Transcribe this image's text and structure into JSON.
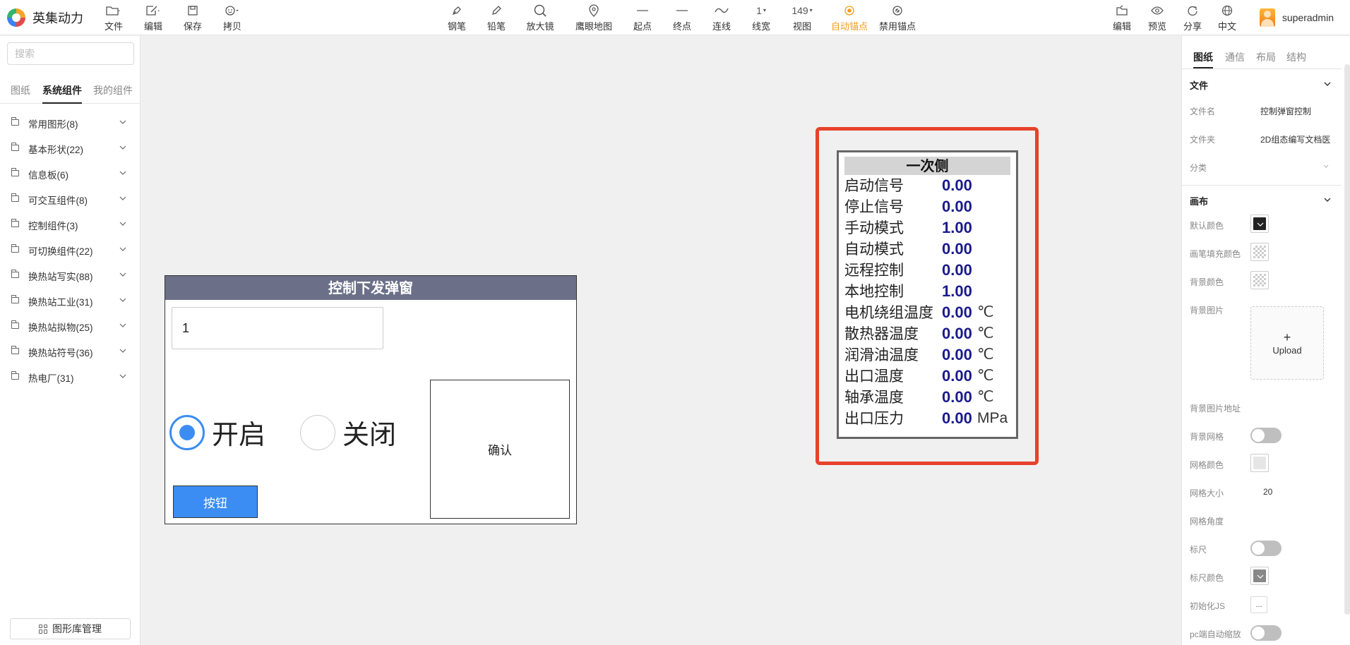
{
  "app": {
    "name": "英集动力",
    "user": "superadmin"
  },
  "toolbar": {
    "left": [
      {
        "label": "文件",
        "icon": "folder-icon"
      },
      {
        "label": "编辑",
        "icon": "edit-icon"
      },
      {
        "label": "保存",
        "icon": "save-icon"
      },
      {
        "label": "拷贝",
        "icon": "smile-icon"
      }
    ],
    "center": [
      {
        "label": "钢笔",
        "icon": "pen-icon"
      },
      {
        "label": "铅笔",
        "icon": "pencil-icon"
      },
      {
        "label": "放大镜",
        "icon": "magnifier-icon"
      },
      {
        "label": "鹰眼地图",
        "icon": "map-pin-icon"
      },
      {
        "label": "起点",
        "icon": "line-start-icon"
      },
      {
        "label": "终点",
        "icon": "line-end-icon"
      },
      {
        "label": "连线",
        "icon": "curve-icon"
      },
      {
        "label": "线宽",
        "value": "1"
      },
      {
        "label": "视图",
        "value": "149"
      },
      {
        "label": "自动锚点",
        "icon": "anchor-icon",
        "active": true
      },
      {
        "label": "禁用锚点",
        "icon": "anchor-disabled-icon"
      }
    ],
    "right": [
      {
        "label": "编辑",
        "icon": "edit-folder-icon"
      },
      {
        "label": "预览",
        "icon": "eye-icon"
      },
      {
        "label": "分享",
        "icon": "share-icon"
      },
      {
        "label": "中文",
        "icon": "globe-icon"
      }
    ]
  },
  "sidebar": {
    "search_placeholder": "搜索",
    "tabs": [
      "图纸",
      "系统组件",
      "我的组件"
    ],
    "active_tab": "系统组件",
    "categories": [
      "常用图形(8)",
      "基本形状(22)",
      "信息板(6)",
      "可交互组件(8)",
      "控制组件(3)",
      "可切换组件(22)",
      "换热站写实(88)",
      "换热站工业(31)",
      "换热站拟物(25)",
      "换热站符号(36)",
      "热电厂(31)"
    ],
    "library_button": "图形库管理"
  },
  "dialog": {
    "title": "控制下发弹窗",
    "input_value": "1",
    "radio_on": "开启",
    "radio_off": "关闭",
    "confirm": "确认",
    "button": "按钮"
  },
  "panel": {
    "title": "一次侧",
    "rows": [
      {
        "name": "启动信号",
        "value": "0.00",
        "unit": ""
      },
      {
        "name": "停止信号",
        "value": "0.00",
        "unit": ""
      },
      {
        "name": "手动模式",
        "value": "1.00",
        "unit": ""
      },
      {
        "name": "自动模式",
        "value": "0.00",
        "unit": ""
      },
      {
        "name": "远程控制",
        "value": "0.00",
        "unit": ""
      },
      {
        "name": "本地控制",
        "value": "1.00",
        "unit": ""
      },
      {
        "name": "电机绕组温度",
        "value": "0.00",
        "unit": "℃"
      },
      {
        "name": "散热器温度",
        "value": "0.00",
        "unit": "℃"
      },
      {
        "name": "润滑油温度",
        "value": "0.00",
        "unit": "℃"
      },
      {
        "name": "出口温度",
        "value": "0.00",
        "unit": "℃"
      },
      {
        "name": "轴承温度",
        "value": "0.00",
        "unit": "℃"
      },
      {
        "name": "出口压力",
        "value": "0.00",
        "unit": "MPa"
      }
    ]
  },
  "rpanel": {
    "tabs": [
      "图纸",
      "通信",
      "布局",
      "结构"
    ],
    "active_tab": "图纸",
    "file_section": "文件",
    "file_name_label": "文件名",
    "file_name_value": "控制弹窗控制",
    "folder_label": "文件夹",
    "folder_value": "2D组态编写文档医",
    "category_label": "分类",
    "canvas_section": "画布",
    "default_color_label": "默认颜色",
    "default_color": "#222222",
    "pen_fill_label": "画笔填充颜色",
    "bg_color_label": "背景颜色",
    "bg_image_label": "背景图片",
    "upload_label": "Upload",
    "bg_image_url_label": "背景图片地址",
    "bg_grid_label": "背景网格",
    "grid_color_label": "网格颜色",
    "grid_size_label": "网格大小",
    "grid_size_value": "20",
    "grid_angle_label": "网格角度",
    "ruler_label": "标尺",
    "ruler_color_label": "标尺颜色",
    "init_js_label": "初始化JS",
    "init_js_btn": "...",
    "pc_zoom_label": "pc端自动缩放"
  }
}
